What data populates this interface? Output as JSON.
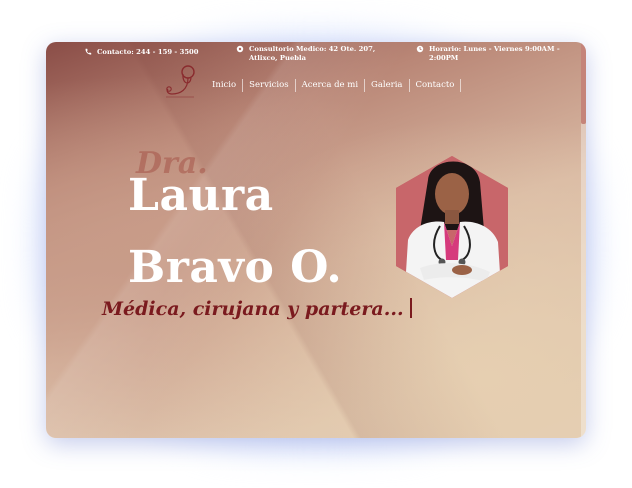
{
  "topbar": {
    "contact": "Contacto: 244 - 159 - 3500",
    "address": "Consultorio Medico: 42 Ote. 207, Atlixco, Puebla",
    "hours": "Horario: Lunes - Viernes 9:00AM - 2:00PM"
  },
  "nav": {
    "items": [
      "Inicio",
      "Servicios",
      "Acerca de mi",
      "Galeria",
      "Contacto"
    ]
  },
  "hero": {
    "prefix": "Dra.",
    "name_line1": "Laura",
    "name_line2": "Bravo O.",
    "tagline": "Médica, cirujana y partera..."
  },
  "colors": {
    "accent": "#7a1a1e",
    "hex_frame": "#c0565a"
  },
  "icons": [
    "phone-icon",
    "location-icon",
    "clock-icon",
    "stethoscope-logo-icon"
  ]
}
